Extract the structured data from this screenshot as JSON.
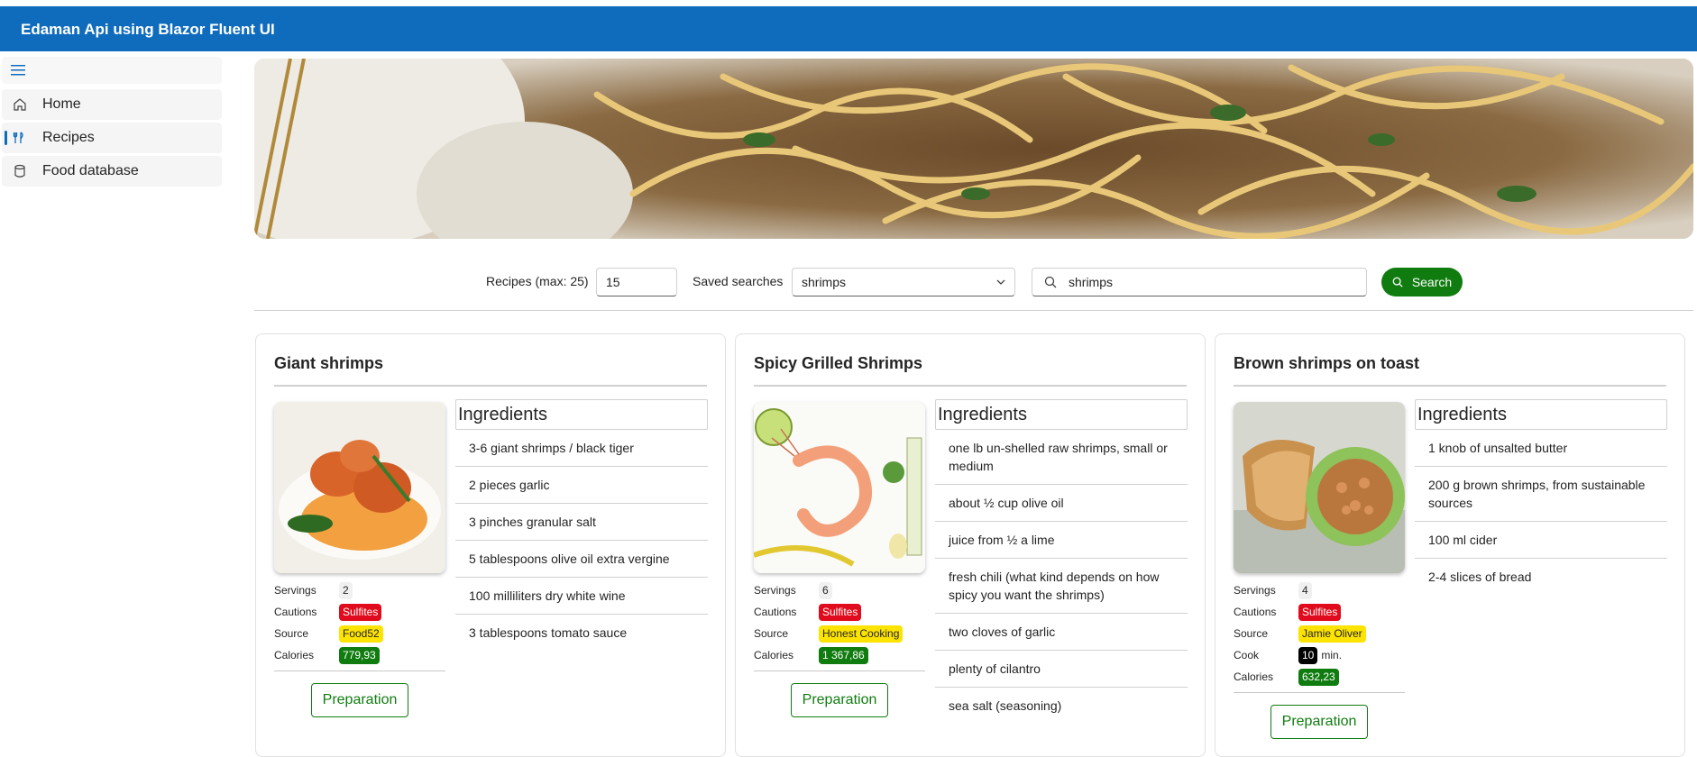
{
  "app": {
    "title": "Edaman Api using Blazor Fluent UI"
  },
  "nav": {
    "items": [
      {
        "label": "Home",
        "icon": "home-icon"
      },
      {
        "label": "Recipes",
        "icon": "food-icon"
      },
      {
        "label": "Food database",
        "icon": "database-icon"
      }
    ]
  },
  "search": {
    "recipes_label": "Recipes (max: 25)",
    "recipes_value": "15",
    "saved_label": "Saved searches",
    "saved_value": "shrimps",
    "query": "shrimps",
    "button_label": "Search"
  },
  "cards": [
    {
      "title": "Giant shrimps",
      "servings_label": "Servings",
      "servings": "2",
      "cautions_label": "Cautions",
      "cautions": "Sulfites",
      "source_label": "Source",
      "source": "Food52",
      "calories_label": "Calories",
      "calories": "779,93",
      "ingredients_header": "Ingredients",
      "ingredients": [
        "3-6 giant shrimps / black tiger",
        "2 pieces garlic",
        "3 pinches granular salt",
        "5 tablespoons olive oil extra vergine",
        "100 milliliters dry white wine",
        "3 tablespoons tomato sauce"
      ],
      "prep_label": "Preparation"
    },
    {
      "title": "Spicy Grilled Shrimps",
      "servings_label": "Servings",
      "servings": "6",
      "cautions_label": "Cautions",
      "cautions": "Sulfites",
      "source_label": "Source",
      "source": "Honest Cooking",
      "calories_label": "Calories",
      "calories": "1 367,86",
      "ingredients_header": "Ingredients",
      "ingredients": [
        "one lb un-shelled raw shrimps, small or medium",
        "about ½ cup olive oil",
        "juice from ½ a lime",
        "fresh chili (what kind depends on how spicy you want the shrimps)",
        "two cloves of garlic",
        "plenty of cilantro",
        "sea salt (seasoning)"
      ],
      "prep_label": "Preparation"
    },
    {
      "title": "Brown shrimps on toast",
      "servings_label": "Servings",
      "servings": "4",
      "cautions_label": "Cautions",
      "cautions": "Sulfites",
      "source_label": "Source",
      "source": "Jamie Oliver",
      "cook_label": "Cook",
      "cook": "10",
      "cook_unit": "min.",
      "calories_label": "Calories",
      "calories": "632,23",
      "ingredients_header": "Ingredients",
      "ingredients": [
        "1 knob of unsalted butter",
        "200 g brown shrimps, from sustainable sources",
        "100 ml cider",
        "2-4 slices of bread"
      ],
      "prep_label": "Preparation"
    }
  ]
}
